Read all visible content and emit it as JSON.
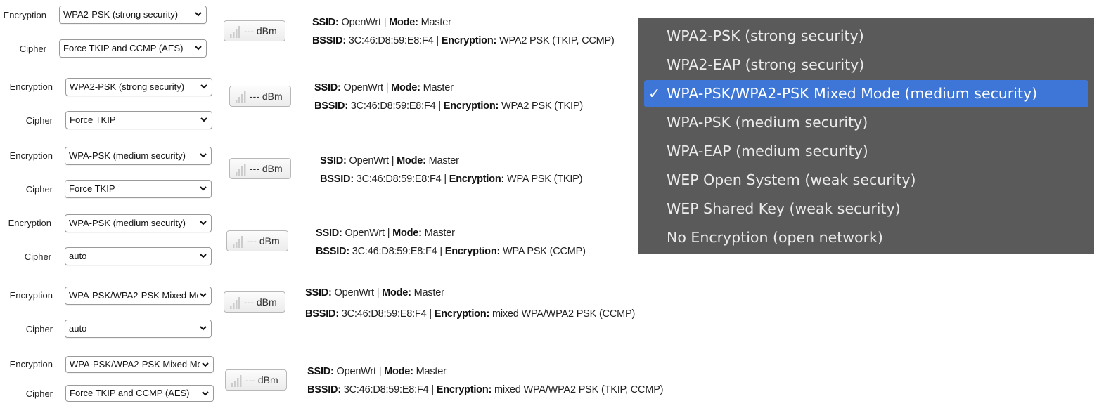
{
  "labels": {
    "encryption": "Encryption",
    "cipher": "Cipher",
    "ssid": "SSID:",
    "mode": "Mode:",
    "bssid": "BSSID:",
    "encryption_info": "Encryption:"
  },
  "rows": [
    {
      "encryption_value": "WPA2-PSK (strong security)",
      "cipher_value": "Force TKIP and CCMP (AES)",
      "signal": "--- dBm",
      "ssid": "OpenWrt",
      "mode": "Master",
      "bssid": "3C:46:D8:59:E8:F4",
      "encryption_detail": "WPA2 PSK (TKIP, CCMP)"
    },
    {
      "encryption_value": "WPA2-PSK (strong security)",
      "cipher_value": "Force TKIP",
      "signal": "--- dBm",
      "ssid": "OpenWrt",
      "mode": "Master",
      "bssid": "3C:46:D8:59:E8:F4",
      "encryption_detail": "WPA2 PSK (TKIP)"
    },
    {
      "encryption_value": "WPA-PSK (medium security)",
      "cipher_value": "Force TKIP",
      "signal": "--- dBm",
      "ssid": "OpenWrt",
      "mode": "Master",
      "bssid": "3C:46:D8:59:E8:F4",
      "encryption_detail": "WPA PSK (TKIP)"
    },
    {
      "encryption_value": "WPA-PSK (medium security)",
      "cipher_value": "auto",
      "signal": "--- dBm",
      "ssid": "OpenWrt",
      "mode": "Master",
      "bssid": "3C:46:D8:59:E8:F4",
      "encryption_detail": "WPA PSK (CCMP)"
    },
    {
      "encryption_value": "WPA-PSK/WPA2-PSK Mixed Mc",
      "cipher_value": "auto",
      "signal": "--- dBm",
      "ssid": "OpenWrt",
      "mode": "Master",
      "bssid": "3C:46:D8:59:E8:F4",
      "encryption_detail": "mixed WPA/WPA2 PSK (CCMP)"
    },
    {
      "encryption_value": "WPA-PSK/WPA2-PSK Mixed Mc",
      "cipher_value": "Force TKIP and CCMP (AES)",
      "signal": "--- dBm",
      "ssid": "OpenWrt",
      "mode": "Master",
      "bssid": "3C:46:D8:59:E8:F4",
      "encryption_detail": "mixed WPA/WPA2 PSK (TKIP, CCMP)"
    }
  ],
  "dropdown": {
    "check_mark": "✓",
    "options": [
      "WPA2-PSK (strong security)",
      "WPA2-EAP (strong security)",
      "WPA-PSK/WPA2-PSK Mixed Mode (medium security)",
      "WPA-PSK (medium security)",
      "WPA-EAP (medium security)",
      "WEP Open System (weak security)",
      "WEP Shared Key (weak security)",
      "No Encryption (open network)"
    ],
    "selected_option": "WPA-PSK/WPA2-PSK Mixed Mode (medium security)"
  },
  "colors": {
    "dropdown_bg": "#5a5a5a",
    "dropdown_selected": "#3d76d6",
    "dropdown_text": "#ececec"
  },
  "icons": {
    "signal": "signal-bars-icon",
    "select_arrow": "chevron-down-icon",
    "check": "checkmark-icon"
  }
}
